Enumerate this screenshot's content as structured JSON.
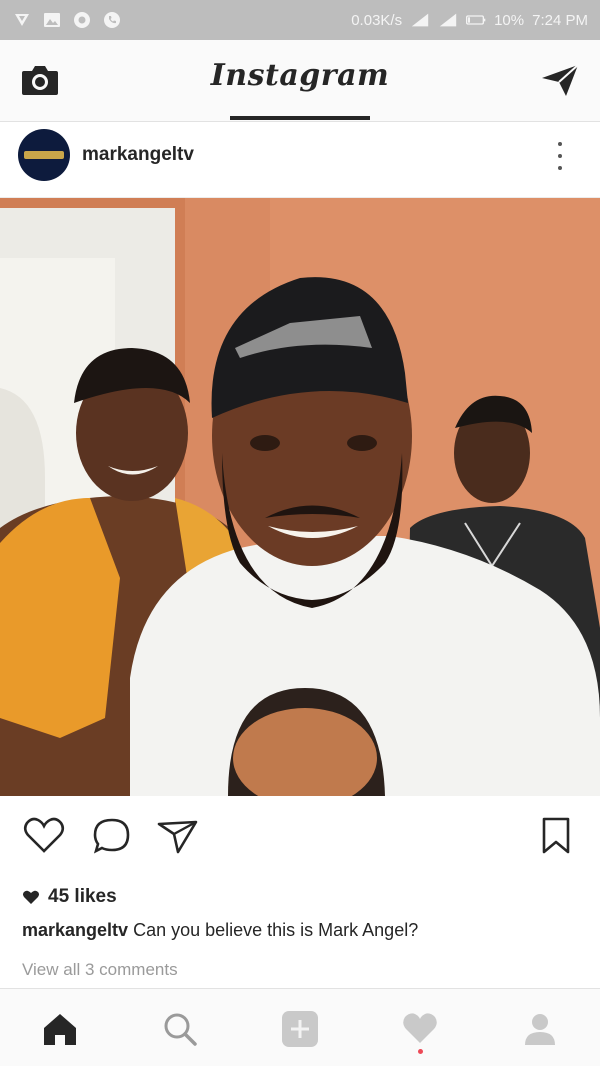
{
  "status_bar": {
    "data_rate": "0.03K/s",
    "battery": "10%",
    "time": "7:24 PM",
    "icons": [
      "vpn-icon",
      "image-icon",
      "browser-icon",
      "phone-icon",
      "signal-icon",
      "signal-icon",
      "battery-icon"
    ]
  },
  "header": {
    "app_title": "Instagram",
    "left_icon": "camera-icon",
    "right_icon": "direct-message-icon"
  },
  "post": {
    "username": "markangeltv",
    "likes": "45 likes",
    "caption_user": "markangeltv",
    "caption_text": " Can you believe this is Mark Angel?",
    "view_comments": "View all 3 comments",
    "actions": [
      "like-icon",
      "comment-icon",
      "share-icon",
      "bookmark-icon"
    ]
  },
  "bottom_nav": {
    "items": [
      "home-icon",
      "search-icon",
      "add-post-icon",
      "activity-icon",
      "profile-icon"
    ],
    "active": "home-icon",
    "notification_color": "#ed4956"
  },
  "colors": {
    "status_bar": "#bdbdbd",
    "wall": "#d68960",
    "text": "#262626",
    "muted": "#9a9a9a"
  }
}
